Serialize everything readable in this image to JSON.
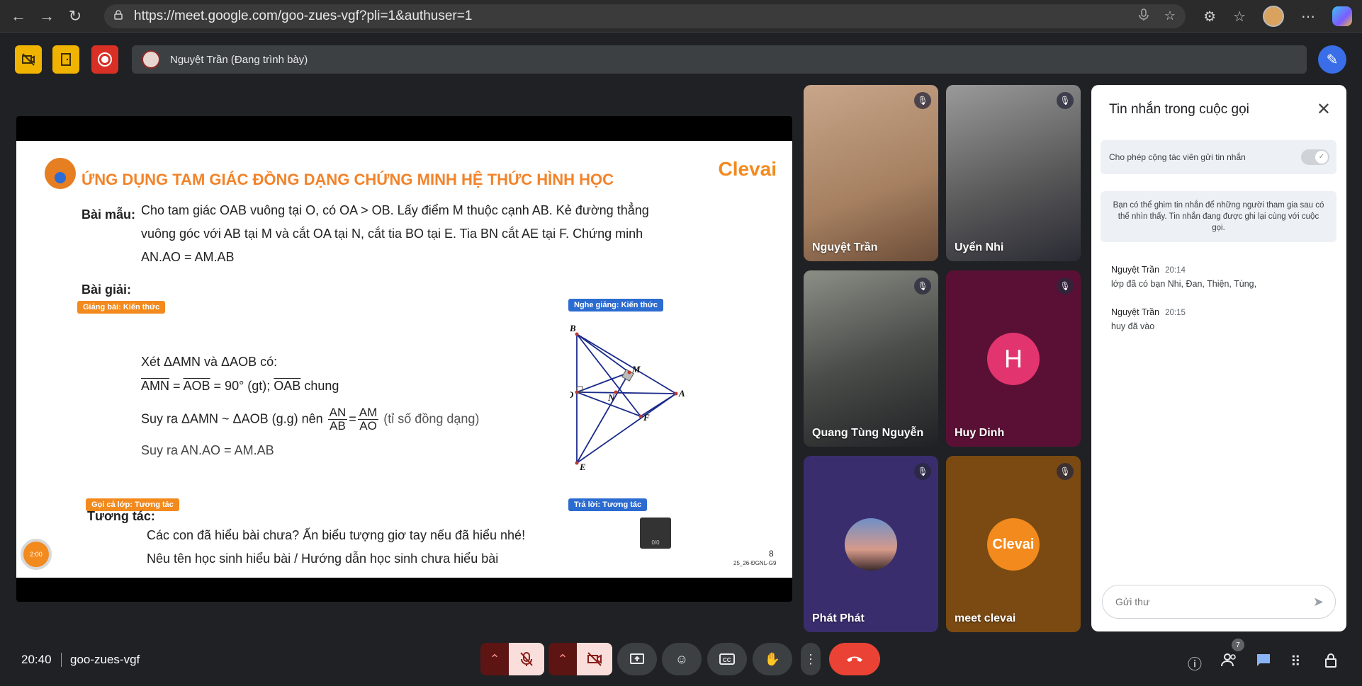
{
  "browser": {
    "url": "https://meet.google.com/goo-zues-vgf?pli=1&authuser=1",
    "back_icon": "←",
    "forward_icon": "→",
    "reload_icon": "↻"
  },
  "presenter": {
    "label": "Nguyệt Trần (Đang trình bày)"
  },
  "slide": {
    "title": "ỨNG DỤNG TAM GIÁC ĐỒNG DẠNG CHỨNG MINH HỆ THỨC HÌNH HỌC",
    "brand": "Clevai",
    "sample_label": "Bài mẫu:",
    "problem_line1": "Cho tam giác OAB vuông tại O, có OA > OB. Lấy điểm M thuộc cạnh AB. Kẻ đường thẳng",
    "problem_line2": "vuông góc với AB tại M và cắt OA tại N, cắt tia BO tại E. Tia BN cắt AE tại F. Chứng minh",
    "problem_line3": "AN.AO = AM.AB",
    "solution_label": "Bài giải:",
    "tag_teach": "Giảng bài: Kiến thức",
    "tag_listen": "Nghe giảng: Kiến thức",
    "tag_call": "Gọi cả lớp: Tương tác",
    "tag_answer": "Trả lời: Tương tác",
    "step1": "Xét ΔAMN và ΔAOB có:",
    "step2_a": "AMN",
    "step2_b": " = ",
    "step2_c": "AOB",
    "step2_d": " = 90° (gt); ",
    "step2_e": "OAB",
    "step2_f": " chung",
    "step3_a": "Suy ra ΔAMN ~ ΔAOB (g.g) nên ",
    "frac1_num": "AN",
    "frac1_den": "AB",
    "eq": "=",
    "frac2_num": "AM",
    "frac2_den": "AO",
    "step3_b": " (tỉ số đồng dạng)",
    "step4": "Suy ra AN.AO = AM.AB",
    "interact_label": "Tương tác:",
    "interact_line1": "Các con đã hiểu bài chưa? Ấn biểu tượng giơ tay nếu đã hiểu nhé!",
    "interact_line2": "Nêu tên học sinh hiểu bài / Hướng dẫn học sinh chưa hiểu bài",
    "timer": "2:00",
    "raise_count": "0/0",
    "page_number": "8",
    "slide_code": "25_26-ĐGNL-G9",
    "diagram_labels": {
      "B": "B",
      "M": "M",
      "O": "O",
      "N": "N",
      "A": "A",
      "F": "F",
      "E": "E"
    }
  },
  "participants": [
    {
      "name": "Nguyệt Trần",
      "muted": true
    },
    {
      "name": "Uyển Nhi",
      "muted": true
    },
    {
      "name": "Quang Tùng Nguyễn",
      "muted": true
    },
    {
      "name": "Huy Dinh",
      "muted": true,
      "initial": "H"
    },
    {
      "name": "Phát Phát",
      "muted": true
    },
    {
      "name": "meet clevai",
      "muted": true,
      "logo": "Clevai"
    }
  ],
  "chat": {
    "title": "Tin nhắn trong cuộc gọi",
    "toggle_label": "Cho phép cộng tác viên gửi tin nhắn",
    "info": "Bạn có thể ghim tin nhắn để những người tham gia sau có thể nhìn thấy. Tin nhắn đang được ghi lại cùng với cuộc gọi.",
    "messages": [
      {
        "sender": "Nguyệt Trần",
        "time": "20:14",
        "body": "lớp đã có bạn Nhi, Đan, Thiện, Tùng,"
      },
      {
        "sender": "Nguyệt Trần",
        "time": "20:15",
        "body": "huy đã vào"
      }
    ],
    "input_placeholder": "Gửi thư"
  },
  "bottom": {
    "time": "20:40",
    "meeting_code": "goo-zues-vgf",
    "participant_count": "7"
  },
  "colors": {
    "accent_orange": "#f28a1e",
    "accent_blue": "#2c6cd1",
    "end_call_red": "#ea4335"
  }
}
